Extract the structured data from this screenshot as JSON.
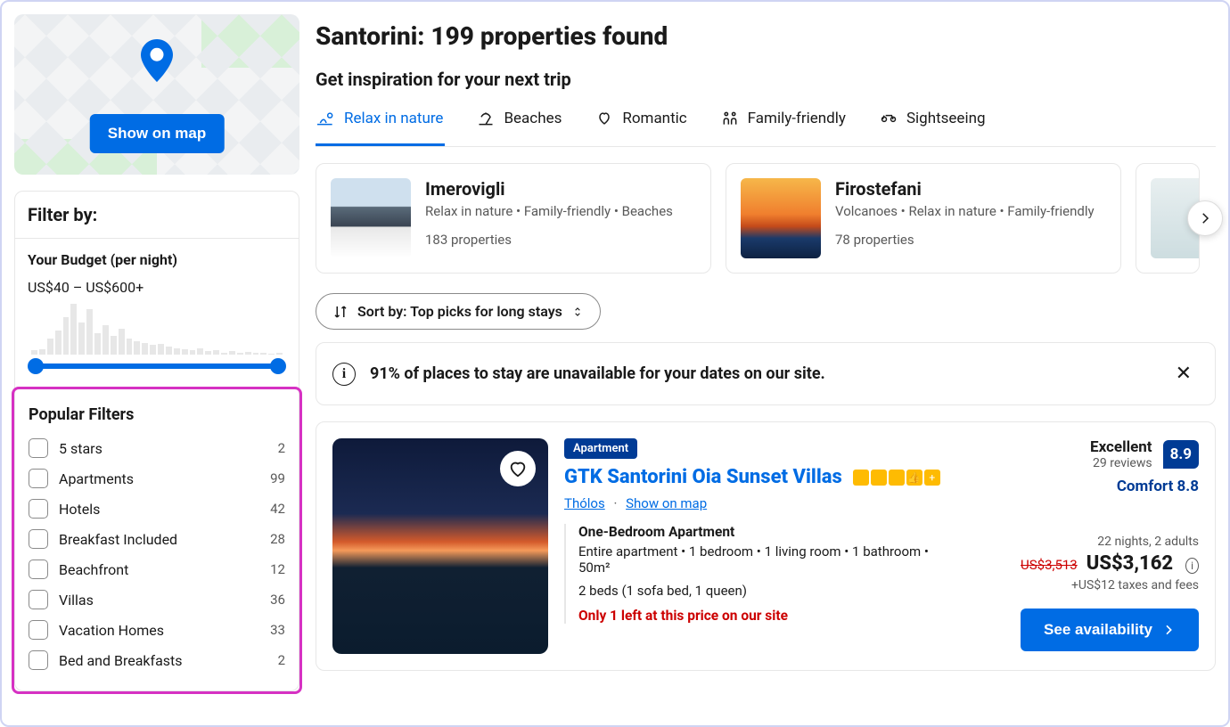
{
  "page_title": "Santorini: 199 properties found",
  "inspiration_heading": "Get inspiration for your next trip",
  "tabs": [
    {
      "label": "Relax in nature",
      "active": true
    },
    {
      "label": "Beaches"
    },
    {
      "label": "Romantic"
    },
    {
      "label": "Family-friendly"
    },
    {
      "label": "Sightseeing"
    }
  ],
  "map": {
    "show_on_map": "Show on map"
  },
  "filter": {
    "header": "Filter by:",
    "budget_title": "Your Budget (per night)",
    "budget_range": "US$40 – US$600+",
    "popular_title": "Popular Filters",
    "popular": [
      {
        "label": "5 stars",
        "count": 2
      },
      {
        "label": "Apartments",
        "count": 99
      },
      {
        "label": "Hotels",
        "count": 42
      },
      {
        "label": "Breakfast Included",
        "count": 28
      },
      {
        "label": "Beachfront",
        "count": 12
      },
      {
        "label": "Villas",
        "count": 36
      },
      {
        "label": "Vacation Homes",
        "count": 33
      },
      {
        "label": "Bed and Breakfasts",
        "count": 2
      }
    ]
  },
  "inspiration": [
    {
      "title": "Imerovigli",
      "tags": "Relax in nature • Family-friendly • Beaches",
      "count": "183 properties"
    },
    {
      "title": "Firostefani",
      "tags": "Volcanoes • Relax in nature • Family-friendly",
      "count": "78 properties"
    }
  ],
  "sort_label": "Sort by: Top picks for long stays",
  "banner_text": "91% of places to stay are unavailable for your dates on our site.",
  "listing": {
    "badge": "Apartment",
    "title": "GTK Santorini Oia Sunset Villas",
    "location": "Thólos",
    "show_on_map": "Show on map",
    "room_title": "One-Bedroom Apartment",
    "room_desc": "Entire apartment • 1 bedroom • 1 living room • 1 bathroom • 50m²",
    "beds": "2 beds (1 sofa bed, 1 queen)",
    "scarcity": "Only 1 left at this price on our site",
    "score_word": "Excellent",
    "reviews": "29 reviews",
    "score": "8.9",
    "comfort": "Comfort 8.8",
    "stay_info": "22 nights, 2 adults",
    "price_old": "US$3,513",
    "price_new": "US$3,162",
    "taxes": "+US$12 taxes and fees",
    "cta": "See availability"
  }
}
